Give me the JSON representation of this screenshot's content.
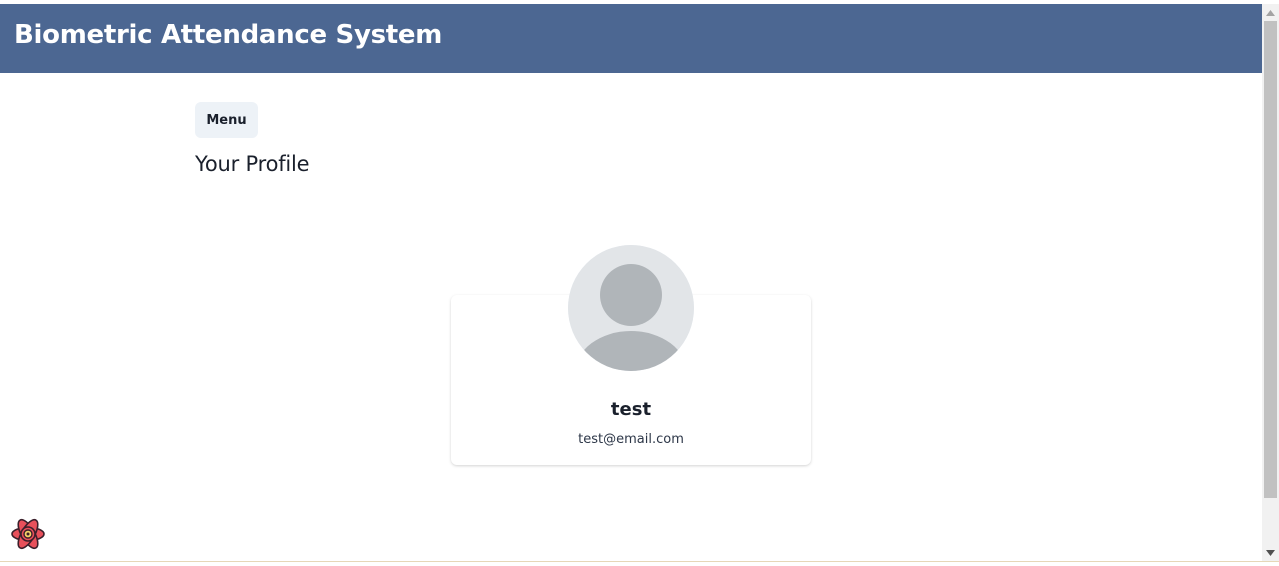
{
  "header": {
    "title": "Biometric Attendance System",
    "background": "#4c6792"
  },
  "toolbar": {
    "menu_label": "Menu"
  },
  "main": {
    "page_title": "Your Profile"
  },
  "profile": {
    "name": "test",
    "email": "test@email.com",
    "avatar_icon": "default-user-avatar-icon"
  },
  "devtools": {
    "icon": "react-devtools-icon"
  },
  "scrollbar": {
    "up_icon": "scroll-up-arrow-icon",
    "down_icon": "scroll-down-arrow-icon"
  }
}
